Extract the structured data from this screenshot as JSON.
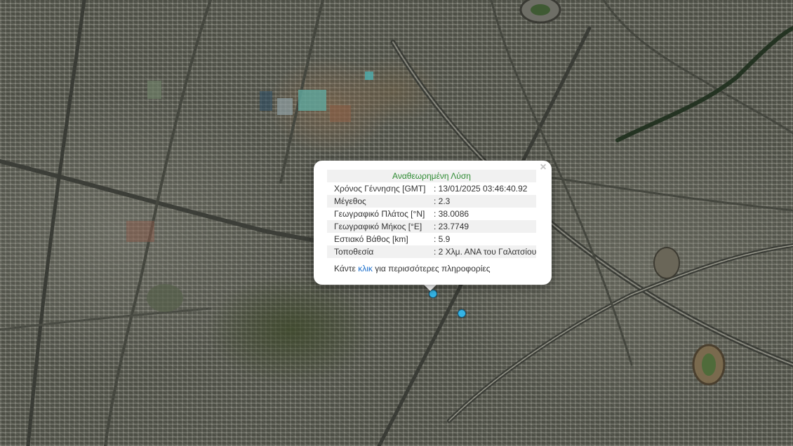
{
  "popup": {
    "title": "Αναθεωρημένη Λύση",
    "close_symbol": "×",
    "rows": [
      {
        "label": "Χρόνος Γέννησης [GMT]",
        "value": ": 13/01/2025 03:46:40.92"
      },
      {
        "label": "Μέγεθος",
        "value": ": 2.3"
      },
      {
        "label": "Γεωγραφικό Πλάτος [°N]",
        "value": ": 38.0086"
      },
      {
        "label": "Γεωγραφικό Μήκος [°E]",
        "value": ": 23.7749"
      },
      {
        "label": "Εστιακό Βάθος [km]",
        "value": ": 5.9"
      },
      {
        "label": "Τοποθεσία",
        "value": ": 2 Χλμ. ΑΝΑ του Γαλατσίου"
      }
    ],
    "footer": {
      "prefix": "Κάντε ",
      "link": "κλικ",
      "suffix": " για περισσότερες πληροφορίες"
    }
  },
  "colors": {
    "title_green": "#2e8b32",
    "link_blue": "#1a6ecc",
    "marker_cyan": "#35b4e6"
  }
}
